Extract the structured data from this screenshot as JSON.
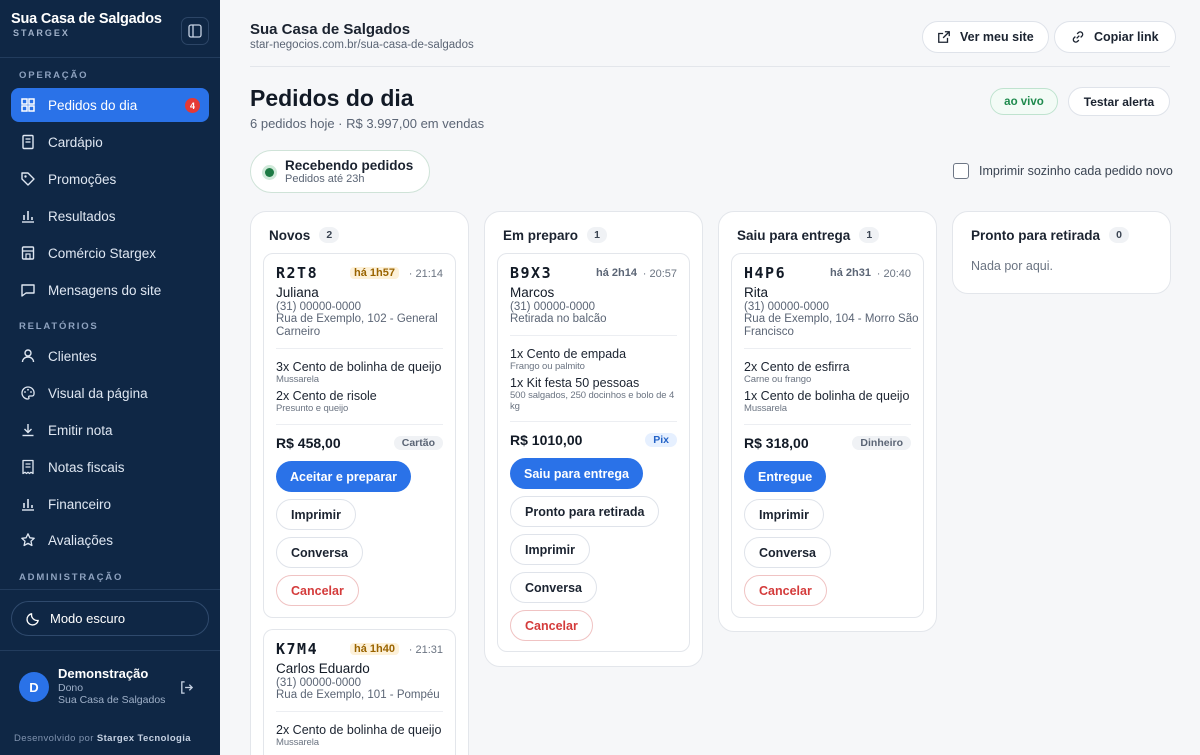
{
  "sidebar": {
    "brand_title": "Sua Casa de Salgados",
    "brand_sub": "STARGEX",
    "sections": {
      "operacao": "OPERAÇÃO",
      "relatorios": "RELATÓRIOS",
      "administracao": "ADMINISTRAÇÃO"
    },
    "items": [
      {
        "label": "Pedidos do dia",
        "badge": "4",
        "icon": "grid-icon"
      },
      {
        "label": "Cardápio",
        "icon": "menu-book-icon"
      },
      {
        "label": "Promoções",
        "icon": "tag-icon"
      },
      {
        "label": "Resultados",
        "icon": "bar-chart-icon"
      },
      {
        "label": "Comércio Stargex",
        "icon": "store-icon"
      },
      {
        "label": "Mensagens do site",
        "icon": "message-icon"
      },
      {
        "label": "Clientes",
        "icon": "user-icon"
      },
      {
        "label": "Visual da página",
        "icon": "palette-icon"
      },
      {
        "label": "Emitir nota",
        "icon": "download-icon"
      },
      {
        "label": "Notas fiscais",
        "icon": "receipt-icon"
      },
      {
        "label": "Financeiro",
        "icon": "bar-chart-icon"
      },
      {
        "label": "Avaliações",
        "icon": "star-icon"
      }
    ],
    "dark_mode": "Modo escuro",
    "user": {
      "initial": "D",
      "name": "Demonstração",
      "role": "Dono",
      "store": "Sua Casa de Salgados"
    },
    "credit_prefix": "Desenvolvido por ",
    "credit_brand": "Stargex Tecnologia"
  },
  "header": {
    "store_name": "Sua Casa de Salgados",
    "store_url": "star-negocios.com.br/sua-casa-de-salgados",
    "view_site": "Ver meu site",
    "copy_link": "Copiar link"
  },
  "page": {
    "title": "Pedidos do dia",
    "subtitle": "6 pedidos hoje · R$ 3.997,00 em vendas",
    "live": "ao vivo",
    "test_alert": "Testar alerta",
    "receiving_title": "Recebendo pedidos",
    "receiving_sub": "Pedidos até 23h",
    "auto_print": "Imprimir sozinho cada pedido novo"
  },
  "columns": [
    {
      "title": "Novos",
      "count": "2"
    },
    {
      "title": "Em preparo",
      "count": "1"
    },
    {
      "title": "Saiu para entrega",
      "count": "1"
    },
    {
      "title": "Pronto para retirada",
      "count": "0",
      "empty": "Nada por aqui."
    }
  ],
  "orders": [
    {
      "code": "R2T8",
      "age": "há 1h57",
      "time": "· 21:14",
      "name": "Juliana",
      "phone": "(31) 00000-0000",
      "address": "Rua de Exemplo, 102 - General Carneiro",
      "items": [
        {
          "name": "3x Cento de bolinha de queijo",
          "note": "Mussarela"
        },
        {
          "name": "2x Cento de risole",
          "note": "Presunto e queijo"
        }
      ],
      "total": "R$ 458,00",
      "payment": "Cartão",
      "actions": [
        "Aceitar e preparar",
        "Imprimir",
        "Conversa",
        "Cancelar"
      ]
    },
    {
      "code": "K7M4",
      "age": "há 1h40",
      "time": "· 21:31",
      "name": "Carlos Eduardo",
      "phone": "(31) 00000-0000",
      "address": "Rua de Exemplo, 101 - Pompéu",
      "items": [
        {
          "name": "2x Cento de bolinha de queijo",
          "note": "Mussarela"
        }
      ]
    },
    {
      "code": "B9X3",
      "age": "há 2h14",
      "time": "· 20:57",
      "name": "Marcos",
      "phone": "(31) 00000-0000",
      "address": "Retirada no balcão",
      "items": [
        {
          "name": "1x Cento de empada",
          "note": "Frango ou palmito"
        },
        {
          "name": "1x Kit festa 50 pessoas",
          "note": "500 salgados, 250 docinhos e bolo de 4 kg"
        }
      ],
      "total": "R$ 1010,00",
      "payment": "Pix",
      "actions": [
        "Saiu para entrega",
        "Pronto para retirada",
        "Imprimir",
        "Conversa",
        "Cancelar"
      ]
    },
    {
      "code": "H4P6",
      "age": "há 2h31",
      "time": "· 20:40",
      "name": "Rita",
      "phone": "(31) 00000-0000",
      "address": "Rua de Exemplo, 104 - Morro São Francisco",
      "items": [
        {
          "name": "2x Cento de esfirra",
          "note": "Carne ou frango"
        },
        {
          "name": "1x Cento de bolinha de queijo",
          "note": "Mussarela"
        }
      ],
      "total": "R$ 318,00",
      "payment": "Dinheiro",
      "actions": [
        "Entregue",
        "Imprimir",
        "Conversa",
        "Cancelar"
      ]
    }
  ]
}
